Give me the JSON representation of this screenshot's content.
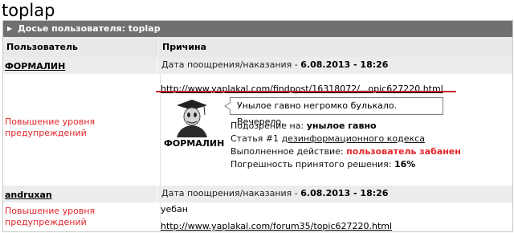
{
  "page_title": "toplap",
  "panel": {
    "title": "Досье пользователя: toplap",
    "col_user": "Пользователь",
    "col_reason": "Причина"
  },
  "entries": [
    {
      "user": "ФОРМАЛИН",
      "date_prefix": "Дата поощрения/наказания -",
      "date": "6.08.2013 - 18:26",
      "violation": "Повышение уровня предупреждений",
      "link": "http://www.yaplakal.com/findpost/16318072/...opic627220.html",
      "quote": "Унылое гавно негромко булькало. Вечерело.",
      "avatar_label": "ФОРМАЛИН",
      "suspicion_label": "Подозрение на:",
      "suspicion_value": "унылое гавно",
      "article_prefix": "Статья #1",
      "article_link": "дезинформационного кодекса",
      "action_label": "Выполненное действие:",
      "action_value": "пользователь забанен",
      "error_label": "Погрешность принятого решения:",
      "error_value": "16%"
    },
    {
      "user": "andruxan",
      "date_prefix": "Дата поощрения/наказания -",
      "date": "6.08.2013 - 18:26",
      "violation": "Повышение уровня предупреждений",
      "comment": "уебан",
      "link": "http://www.yaplakal.com/forum35/topic627220.html"
    }
  ],
  "colors": {
    "header_bg": "#6f7072",
    "row_grey": "#ececec",
    "violation_red": "#e2262a",
    "underline_red": "#c8232b"
  }
}
